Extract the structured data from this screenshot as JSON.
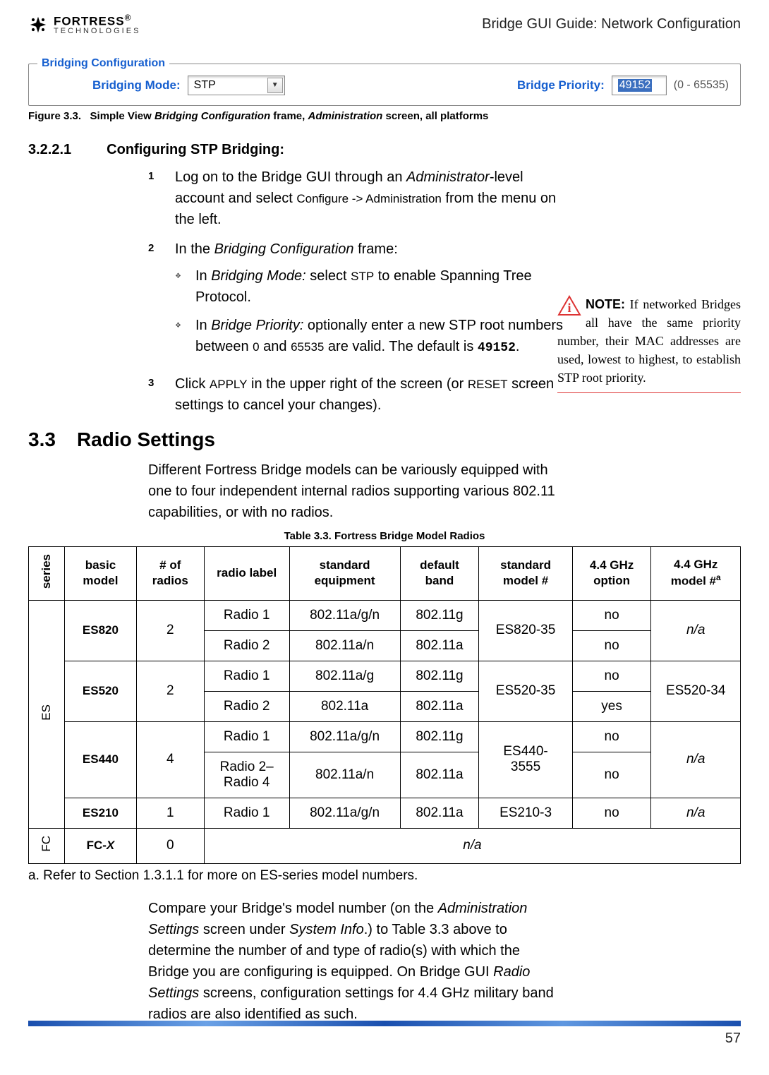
{
  "header": {
    "logo_top": "FORTRESS",
    "logo_sub": "TECHNOLOGIES",
    "right_text": "Bridge GUI Guide: Network Configuration"
  },
  "frame": {
    "legend": "Bridging Configuration",
    "mode_label": "Bridging Mode:",
    "mode_value": "STP",
    "priority_label": "Bridge Priority:",
    "priority_value": "49152",
    "priority_range": "(0 - 65535)"
  },
  "figure_caption": {
    "prefix": "Figure 3.3.",
    "text_a": "Simple View ",
    "text_b": "Bridging Configuration",
    "text_c": " frame, ",
    "text_d": "Administration",
    "text_e": " screen, all platforms"
  },
  "section1": {
    "num": "3.2.2.1",
    "title": "Configuring STP Bridging:"
  },
  "steps": {
    "s1a": "Log on to the Bridge GUI through an ",
    "s1b": "Administrator",
    "s1c": "-level account and select ",
    "s1d": "Configure -> Administration",
    "s1e": " from the menu on the left.",
    "s2a": "In the ",
    "s2b": "Bridging Configuration",
    "s2c": " frame:",
    "s2_1a": "In ",
    "s2_1b": "Bridging Mode:",
    "s2_1c": " select ",
    "s2_1d": "STP",
    "s2_1e": " to enable Spanning Tree Protocol.",
    "s2_2a": "In ",
    "s2_2b": "Bridge Priority:",
    "s2_2c": " optionally enter a new STP root numbers between ",
    "s2_2d": "0",
    "s2_2e": " and ",
    "s2_2f": "65535",
    "s2_2g": " are valid. The default is ",
    "s2_2h": "49152",
    "s2_2i": ".",
    "s3a": "Click ",
    "s3b": "APPLY",
    "s3c": " in the upper right of the screen (or ",
    "s3d": "RESET",
    "s3e": " screen settings to cancel your changes)."
  },
  "note": {
    "title": "NOTE:",
    "body": " If networked Bridges all have the same priority number, their MAC addresses are used, lowest to highest, to establish STP root priority."
  },
  "section2": {
    "num": "3.3",
    "title": "Radio Settings"
  },
  "para1": "Different Fortress Bridge models can be variously equipped with one to four independent internal radios supporting various 802.11 capabilities, or with no radios.",
  "table_caption": "Table 3.3. Fortress Bridge Model Radios",
  "table": {
    "headers": {
      "series": "series",
      "basic_model": "basic model",
      "num_radios": "# of radios",
      "radio_label": "radio label",
      "std_equip": "standard equipment",
      "def_band": "default band",
      "std_model": "standard model #",
      "opt_44": "4.4 GHz option",
      "model_44": "4.4 GHz model #",
      "model_44_sup": "a"
    },
    "series_es": "ES",
    "series_fc": "FC",
    "es820": {
      "model": "ES820",
      "radios": "2",
      "r1_label": "Radio 1",
      "r1_eq": "802.11a/g/n",
      "r1_band": "802.11g",
      "std": "ES820-35",
      "r1_opt": "no",
      "m44": "n/a",
      "r2_label": "Radio 2",
      "r2_eq": "802.11a/n",
      "r2_band": "802.11a",
      "r2_opt": "no"
    },
    "es520": {
      "model": "ES520",
      "radios": "2",
      "r1_label": "Radio 1",
      "r1_eq": "802.11a/g",
      "r1_band": "802.11g",
      "std": "ES520-35",
      "r1_opt": "no",
      "m44": "ES520-34",
      "r2_label": "Radio 2",
      "r2_eq": "802.11a",
      "r2_band": "802.11a",
      "r2_opt": "yes"
    },
    "es440": {
      "model": "ES440",
      "radios": "4",
      "r1_label": "Radio 1",
      "r1_eq": "802.11a/g/n",
      "r1_band": "802.11g",
      "std": "ES440-3555",
      "r1_opt": "no",
      "m44": "n/a",
      "r2_label": "Radio 2–Radio 4",
      "r2_eq": "802.11a/n",
      "r2_band": "802.11a",
      "r2_opt": "no"
    },
    "es210": {
      "model": "ES210",
      "radios": "1",
      "r1_label": "Radio 1",
      "r1_eq": "802.11a/g/n",
      "r1_band": "802.11a",
      "std": "ES210-3",
      "r1_opt": "no",
      "m44": "n/a"
    },
    "fcx": {
      "model": "FC-X",
      "radios": "0",
      "na": "n/a"
    }
  },
  "footnote": "a. Refer to Section 1.3.1.1 for more on ES-series model numbers.",
  "para2a": "Compare your Bridge's model number (on the ",
  "para2b": "Administration Settings",
  "para2c": " screen under ",
  "para2d": "System Info",
  "para2e": ".) to Table 3.3 above to determine the number of and type of radio(s) with which the Bridge you are configuring is equipped. On Bridge GUI ",
  "para2f": "Radio Settings",
  "para2g": " screens, configuration settings for 4.4 GHz military band radios are also identified as such.",
  "page_num": "57"
}
